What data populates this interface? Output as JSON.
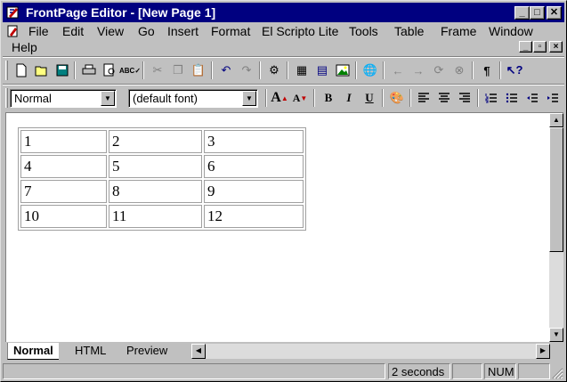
{
  "window": {
    "title": "FrontPage Editor - [New Page 1]",
    "controls": {
      "minimize": "_",
      "maximize": "□",
      "close": "✕"
    }
  },
  "menubar": {
    "items": [
      "File",
      "Edit",
      "View",
      "Go",
      "Insert",
      "Format",
      "El Scripto Lite",
      "Tools",
      "Table",
      "Frame",
      "Window",
      "Help"
    ]
  },
  "standard_toolbar": {
    "icons": [
      "new-page",
      "open",
      "save",
      "print",
      "print-preview",
      "spelling",
      "cut",
      "copy",
      "paste",
      "undo",
      "redo",
      "web-bot",
      "insert-table",
      "table",
      "image",
      "hyperlink",
      "back",
      "forward",
      "refresh",
      "stop",
      "show-all",
      "help"
    ]
  },
  "format_toolbar": {
    "style_value": "Normal",
    "font_value": "(default font)",
    "buttons": {
      "bold": "B",
      "italic": "I",
      "underline": "U",
      "increase_font": "A",
      "decrease_font": "A",
      "pilcrow": "¶"
    }
  },
  "document": {
    "table": [
      [
        "1",
        "2",
        "3"
      ],
      [
        "4",
        "5",
        "6"
      ],
      [
        "7",
        "8",
        "9"
      ],
      [
        "10",
        "11",
        "12"
      ]
    ]
  },
  "tabs": {
    "normal": "Normal",
    "html": "HTML",
    "preview": "Preview",
    "active": "Normal"
  },
  "statusbar": {
    "time": "2 seconds",
    "num": "NUM"
  }
}
